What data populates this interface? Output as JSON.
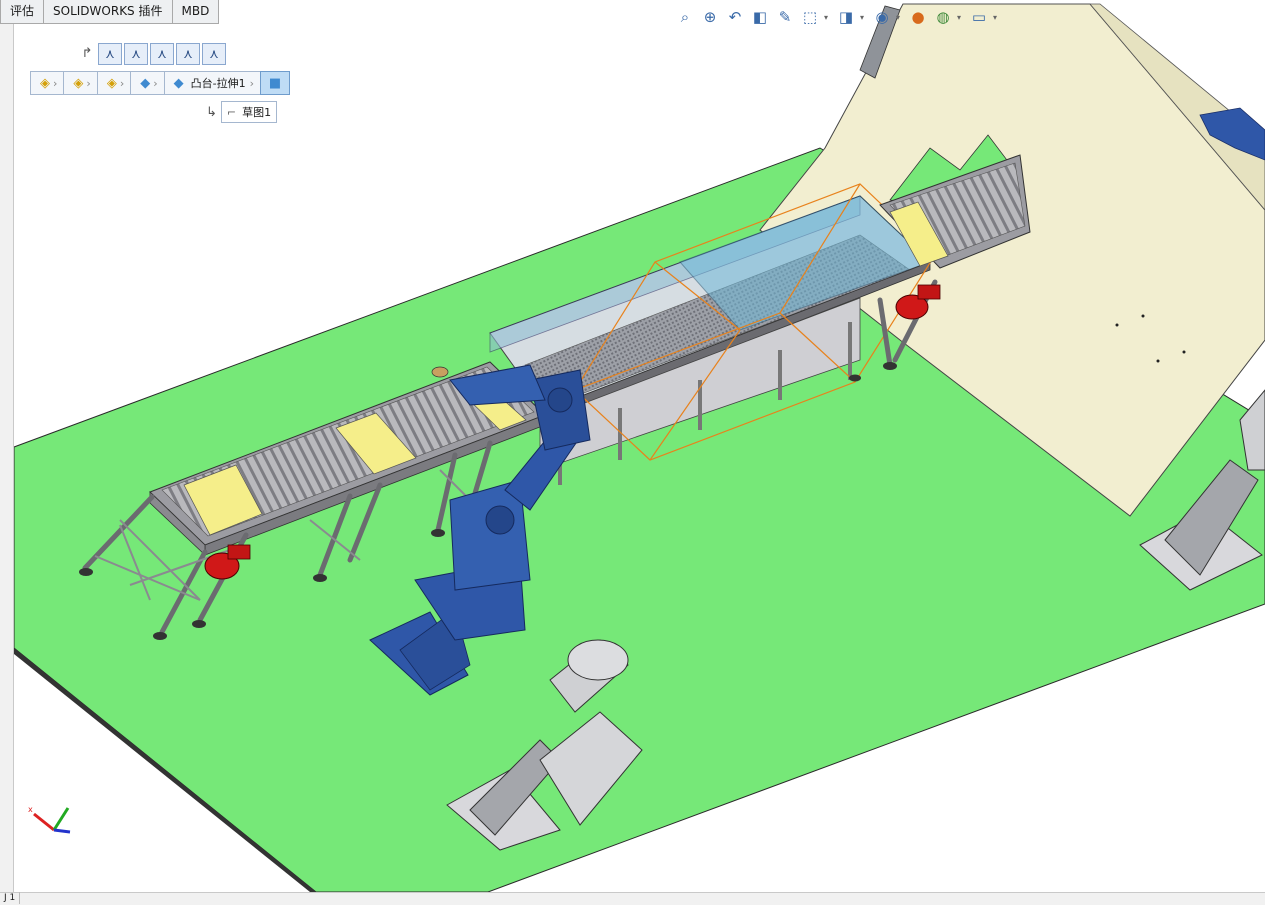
{
  "tabs": [
    {
      "label": "评估"
    },
    {
      "label": "SOLIDWORKS 插件"
    },
    {
      "label": "MBD"
    }
  ],
  "view_toolbar": {
    "icons": [
      "zoom-to-fit-icon",
      "zoom-area-icon",
      "previous-view-icon",
      "section-view-icon",
      "dynamic-annotation-icon",
      "view-orientation-icon",
      "display-style-icon",
      "hide-show-icon",
      "edit-appearance-icon",
      "apply-scene-icon",
      "view-settings-icon"
    ]
  },
  "breadcrumb": {
    "items": [
      {
        "icon": "assembly-icon",
        "label": ""
      },
      {
        "icon": "subassembly-icon",
        "label": ""
      },
      {
        "icon": "subassembly-icon",
        "label": ""
      },
      {
        "icon": "part-icon",
        "label": ""
      },
      {
        "icon": "part-icon",
        "label": "凸台-拉伸1"
      },
      {
        "icon": "face-icon",
        "label": ""
      }
    ],
    "sketch_label": "草图1"
  },
  "status": {
    "sheet_label": "J 1"
  },
  "colors": {
    "floor": "#76e878",
    "conveyor_frame": "#a8a8ab",
    "robot": "#2f57a8",
    "motor": "#d01818",
    "pad": "#f5ee8a",
    "wall": "#f2eed0",
    "glass": "#6fb8d8",
    "selection": "#e8821c"
  }
}
